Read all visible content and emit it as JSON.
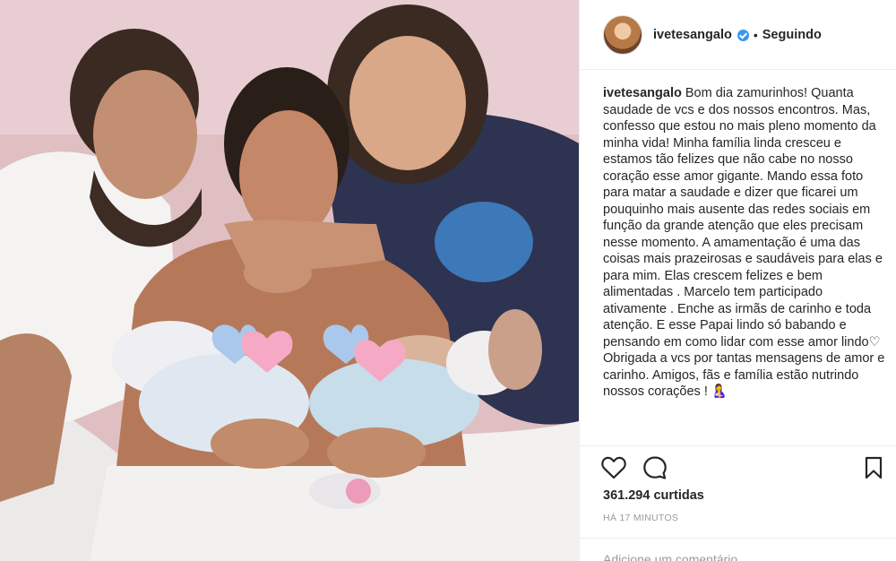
{
  "post": {
    "username": "ivetesangalo",
    "separator": "•",
    "follow_status": "Seguindo",
    "caption_text": " Bom dia zamurinhos! Quanta saudade de vcs e dos nossos encontros. Mas, confesso que estou no mais pleno momento da minha vida! Minha família linda cresceu e estamos tão felizes que não cabe no nosso coração esse amor gigante. Mando essa foto para matar a saudade e dizer que ficarei um pouquinho mais ausente das redes sociais em função da grande atenção que eles precisam nesse momento. A amamentação é uma das coisas mais prazeirosas e saudáveis para elas e para mim. Elas crescem felizes e bem alimentadas . Marcelo tem participado ativamente . Enche as irmãs de carinho e toda atenção. E esse Papai lindo só babando e pensando em como lidar com esse amor lindo♡\nObrigada a vcs por tantas mensagens de amor e carinho. Amigos, fãs e família estão nutrindo nossos corações ! 🤱",
    "likes": "361.294 curtidas",
    "time_ago": "HÁ 17 MINUTOS",
    "comment_placeholder": "Adicione um comentário..."
  },
  "icons": {
    "like": "heart-outline-icon",
    "comment": "speech-bubble-icon",
    "save": "bookmark-icon",
    "verified": "verified-badge-icon"
  },
  "colors": {
    "verified": "#3897f0",
    "text": "#262626",
    "muted": "#999999",
    "divider": "#efefef"
  }
}
